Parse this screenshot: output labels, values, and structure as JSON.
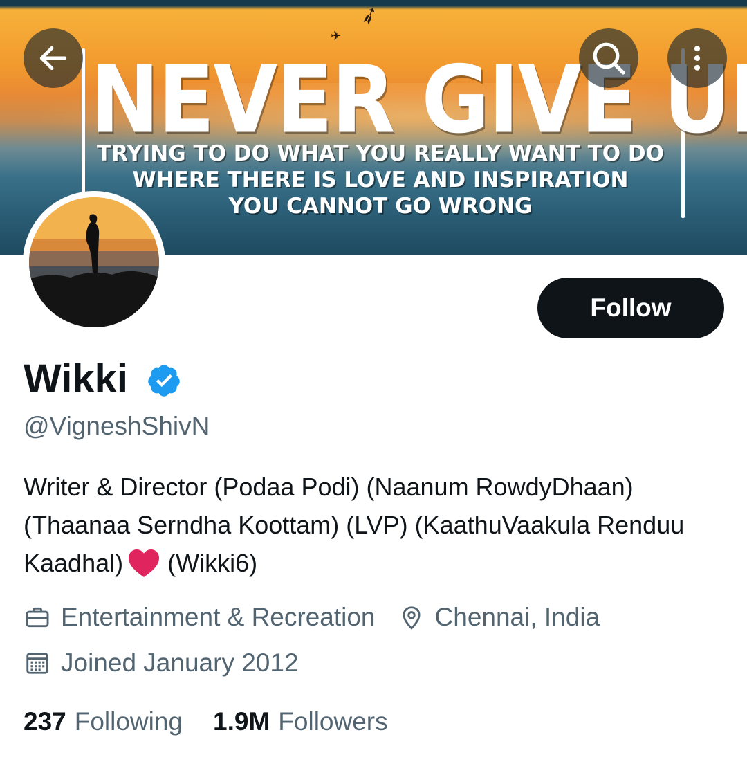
{
  "banner": {
    "headline": "NEVER GIVE UP.",
    "line1": "TRYING TO DO WHAT YOU REALLY WANT TO DO",
    "line2": "WHERE THERE IS LOVE AND INSPIRATION",
    "line3": "YOU CANNOT GO WRONG"
  },
  "nav": {
    "back_icon": "arrow-left-icon",
    "search_icon": "search-icon",
    "more_icon": "more-vertical-icon"
  },
  "profile": {
    "name": "Wikki",
    "handle": "@VigneshShivN",
    "verified": true,
    "follow_label": "Follow",
    "bio_text": "Writer & Director (Podaa Podi) (Naanum RowdyDhaan) (Thaanaa Serndha Koottam) (LVP) (KaathuVaakula Renduu Kaadhal)",
    "bio_suffix": "(Wikki6)",
    "category": "Entertainment & Recreation",
    "location": "Chennai, India",
    "joined": "Joined January 2012",
    "following_count": "237",
    "following_label": "Following",
    "followers_count": "1.9M",
    "followers_label": "Followers"
  },
  "colors": {
    "accent_verified": "#1d9bf0",
    "follow_button_bg": "#0f1419",
    "secondary_text": "#536471",
    "heart": "#e0245e"
  }
}
